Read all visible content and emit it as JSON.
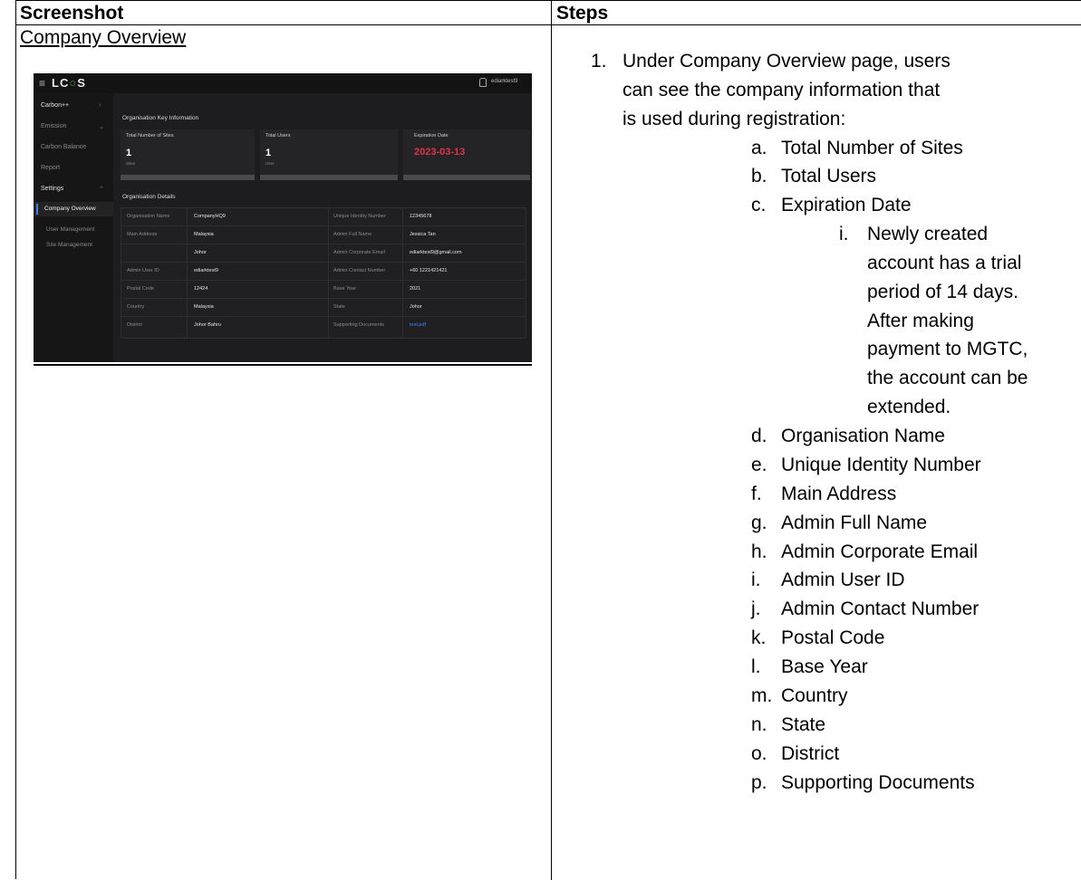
{
  "header": {
    "col_screenshot": "Screenshot",
    "col_steps": "Steps"
  },
  "section_title": "Company Overview",
  "app": {
    "logo": "LCOS",
    "user": "ediarktest9",
    "sidebar": {
      "carbon": "Carbon++",
      "emission": "Emission",
      "carbon_balance": "Carbon Balance",
      "report": "Report",
      "settings": "Settings",
      "company_overview": "Company Overview",
      "user_management": "User Management",
      "site_management": "Site Management"
    },
    "key_info_title": "Organisation Key Information",
    "cards": [
      {
        "label": "Total Number of Sites",
        "value": "1",
        "unit": "Sites"
      },
      {
        "label": "Total Users",
        "value": "1",
        "unit": "User"
      },
      {
        "label": "Expiration Date",
        "value": "2023-03-13"
      }
    ],
    "details_title": "Organisation Details",
    "details_rows": [
      {
        "l1": "Organisation Name",
        "v1": "CompanyHQ9",
        "l2": "Unique Identity Number",
        "v2": "12345678"
      },
      {
        "l1": "Main Address",
        "v1": "Malaysia",
        "l2": "Admin Full Name",
        "v2": "Jessica Tan"
      },
      {
        "l1": "",
        "v1": "Johor",
        "l2": "Admin Corporate Email",
        "v2": "ediarktest9@gmail.com"
      },
      {
        "l1": "Admin User ID",
        "v1": "ediarktest9",
        "l2": "Admin Contact Number",
        "v2": "+60 1221421421"
      },
      {
        "l1": "Postal Code",
        "v1": "12424",
        "l2": "Base Year",
        "v2": "2021"
      },
      {
        "l1": "Country",
        "v1": "Malaysia",
        "l2": "State",
        "v2": "Johor"
      },
      {
        "l1": "District",
        "v1": "Johor Bahru",
        "l2": "Supporting Documents",
        "v2": "test.pdf"
      }
    ]
  },
  "steps": {
    "step1_num": "1.",
    "step1_lines": [
      "Under Company Overview page, users",
      "can see the company information that",
      "is used during registration:"
    ],
    "items": [
      {
        "m": "a.",
        "t": "Total Number of Sites"
      },
      {
        "m": "b.",
        "t": "Total Users"
      },
      {
        "m": "c.",
        "t": "Expiration Date"
      }
    ],
    "sub_marker": "i.",
    "sub_lines": [
      "Newly created",
      "account has a trial",
      "period of 14 days.",
      "After making",
      "payment to MGTC,",
      "the account can be",
      "extended."
    ],
    "items2": [
      {
        "m": "d.",
        "t": "Organisation Name"
      },
      {
        "m": "e.",
        "t": "Unique Identity Number"
      },
      {
        "m": "f.",
        "t": "Main Address"
      },
      {
        "m": "g.",
        "t": "Admin Full Name"
      },
      {
        "m": "h.",
        "t": "Admin Corporate Email"
      },
      {
        "m": "i.",
        "t": "Admin User ID"
      },
      {
        "m": "j.",
        "t": "Admin Contact Number"
      },
      {
        "m": "k.",
        "t": "Postal Code"
      },
      {
        "m": "l.",
        "t": "Base Year"
      },
      {
        "m": "m.",
        "t": "Country"
      },
      {
        "m": "n.",
        "t": "State"
      },
      {
        "m": "o.",
        "t": "District"
      },
      {
        "m": "p.",
        "t": "Supporting Documents"
      }
    ]
  }
}
